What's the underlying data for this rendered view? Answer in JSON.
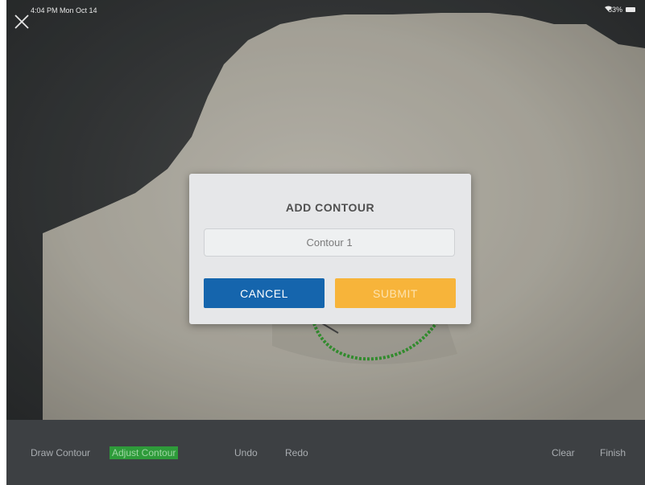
{
  "status_bar": {
    "time": "4:04 PM  Mon Oct 14",
    "battery": "83%"
  },
  "icons": {
    "close": "close-icon",
    "wifi": "wifi-icon",
    "battery": "battery-icon"
  },
  "dialog": {
    "title": "ADD CONTOUR",
    "input_value": "Contour 1",
    "cancel_label": "CANCEL",
    "submit_label": "SUBMIT"
  },
  "toolbar": {
    "draw_contour": "Draw Contour",
    "adjust_contour": "Adjust Contour",
    "undo": "Undo",
    "redo": "Redo",
    "clear": "Clear",
    "finish": "Finish"
  },
  "colors": {
    "cancel": "#1565ad",
    "submit": "#f7b43a",
    "contour": "#3fb23a",
    "active_tool": "#2e9b3a"
  }
}
